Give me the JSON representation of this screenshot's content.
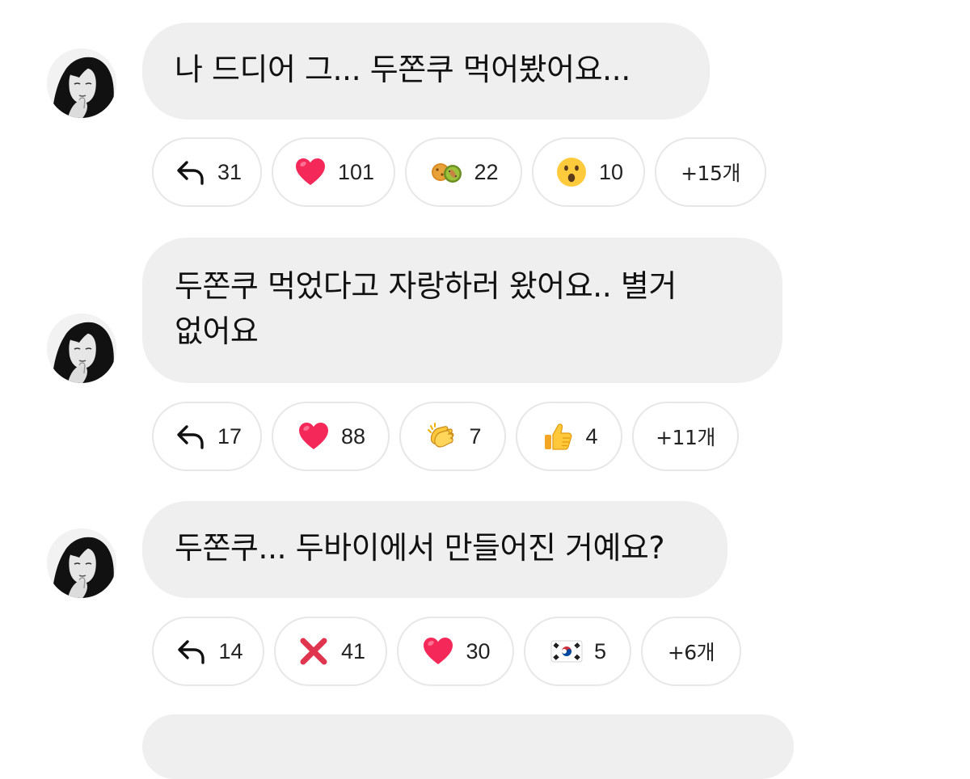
{
  "comments": [
    {
      "lines": [
        "나 드디어 그... 두쫀쿠 먹어봤어요..."
      ],
      "reactions": {
        "reply": "31",
        "r1": "101",
        "r2": "22",
        "r3": "10",
        "more": "+15개"
      },
      "reaction_icons": [
        "reply-arrow-icon",
        "red-heart-icon",
        "cookies-icon",
        "surprised-face-icon"
      ]
    },
    {
      "lines": [
        "두쫀쿠 먹었다고 자랑하러 왔어요.. 별거",
        "없어요"
      ],
      "reactions": {
        "reply": "17",
        "r1": "88",
        "r2": "7",
        "r3": "4",
        "more": "+11개"
      },
      "reaction_icons": [
        "reply-arrow-icon",
        "red-heart-icon",
        "clapping-hands-icon",
        "thumbs-up-icon"
      ]
    },
    {
      "lines": [
        "두쫀쿠... 두바이에서 만들어진 거예요?"
      ],
      "reactions": {
        "reply": "14",
        "r1": "41",
        "r2": "30",
        "r3": "5",
        "more": "+6개"
      },
      "reaction_icons": [
        "reply-arrow-icon",
        "red-x-icon",
        "red-heart-icon",
        "korea-flag-icon"
      ]
    }
  ],
  "colors": {
    "bubble": "#efefef",
    "chip_border": "#e7e7e7",
    "heart": "#f4295a",
    "cross": "#e0354f"
  }
}
